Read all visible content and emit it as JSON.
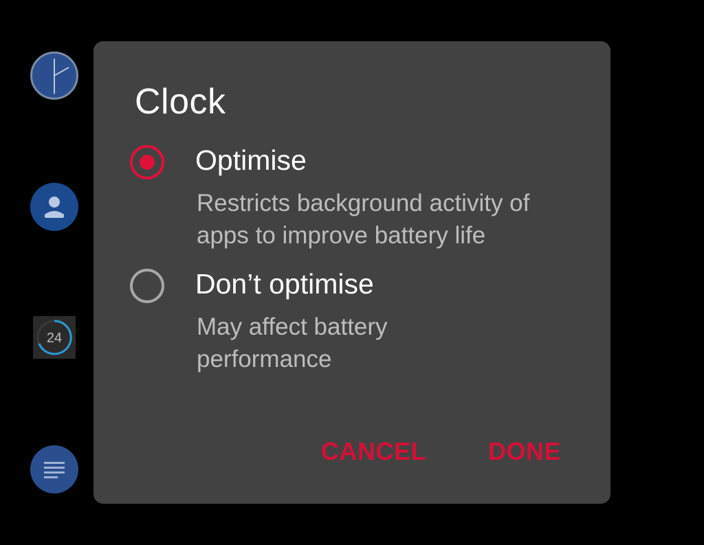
{
  "background": {
    "timer_icon_text": "24"
  },
  "dialog": {
    "title": "Clock",
    "options": [
      {
        "label": "Optimise",
        "description": "Restricts background activity of apps to improve battery life",
        "selected": true
      },
      {
        "label": "Don’t optimise",
        "description": "May affect battery performance",
        "selected": false
      }
    ],
    "cancel_label": "CANCEL",
    "done_label": "DONE"
  },
  "colors": {
    "accent": "#e0103a",
    "dialog_bg": "#424242",
    "screen_bg": "#000000"
  }
}
